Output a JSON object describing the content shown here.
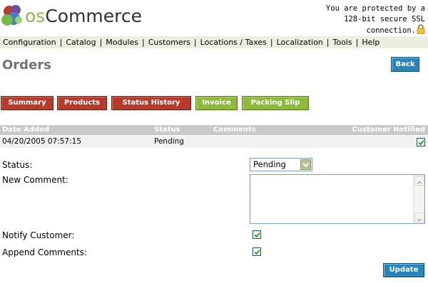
{
  "header": {
    "logo_text_os": "os",
    "logo_text_commerce": "Commerce",
    "ssl_line1": "You are protected by a",
    "ssl_line2": "128-bit secure SSL",
    "ssl_line3": "connection."
  },
  "menu": {
    "items": [
      {
        "label": "Configuration"
      },
      {
        "label": "Catalog"
      },
      {
        "label": "Modules"
      },
      {
        "label": "Customers"
      },
      {
        "label": "Locations / Taxes"
      },
      {
        "label": "Localization"
      },
      {
        "label": "Tools"
      },
      {
        "label": "Help"
      }
    ]
  },
  "page": {
    "title": "Orders",
    "back_label": "Back"
  },
  "tabs": [
    {
      "label": "Summary",
      "color": "#b83a2a"
    },
    {
      "label": "Products",
      "color": "#b83a2a"
    },
    {
      "label": "Status History",
      "color": "#b83a2a"
    },
    {
      "label": "Invoice",
      "color": "#8dba38"
    },
    {
      "label": "Packing Slip",
      "color": "#8dba38"
    }
  ],
  "history": {
    "columns": {
      "date": "Date Added",
      "status": "Status",
      "comments": "Comments",
      "notified": "Customer Notified"
    },
    "rows": [
      {
        "date": "04/20/2005 07:57:15",
        "status": "Pending",
        "comments": "",
        "notified": true
      }
    ]
  },
  "form": {
    "status_label": "Status:",
    "status_value": "Pending",
    "comment_label": "New Comment:",
    "comment_value": "",
    "notify_label": "Notify Customer:",
    "notify_checked": true,
    "append_label": "Append Comments:",
    "append_checked": true,
    "update_label": "Update"
  },
  "colors": {
    "accent_blue": "#2a84b8",
    "tab_red": "#b83a2a",
    "tab_green": "#8dba38",
    "menu_bg": "#eeeddf"
  }
}
